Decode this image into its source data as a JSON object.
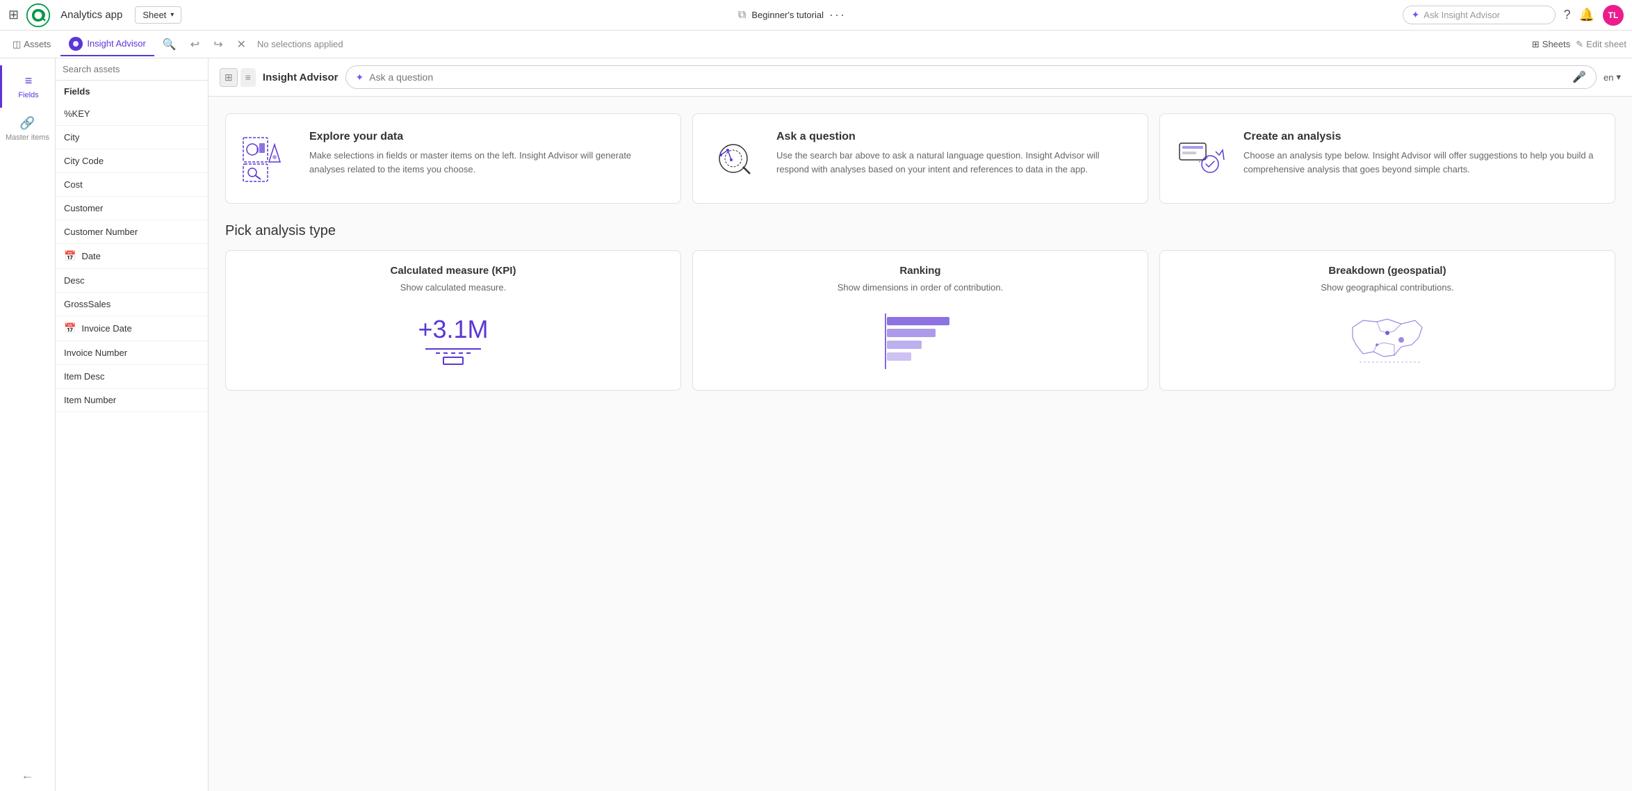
{
  "topNav": {
    "appTitle": "Analytics app",
    "sheetLabel": "Sheet",
    "tutorialLabel": "Beginner's tutorial",
    "askInsightPlaceholder": "Ask Insight Advisor",
    "avatarInitials": "TL"
  },
  "secondToolbar": {
    "assetsLabel": "Assets",
    "insightAdvisorLabel": "Insight Advisor",
    "noSelectionsLabel": "No selections applied",
    "sheetsLabel": "Sheets",
    "editSheetLabel": "Edit sheet"
  },
  "sidebar": {
    "title": "Insight Advisor",
    "searchPlaceholder": "Search assets",
    "fieldsLabel": "Fields",
    "masterItemsLabel": "Master items",
    "fields": [
      {
        "name": "%KEY",
        "type": "text"
      },
      {
        "name": "City",
        "type": "text"
      },
      {
        "name": "City Code",
        "type": "text"
      },
      {
        "name": "Cost",
        "type": "text"
      },
      {
        "name": "Customer",
        "type": "text"
      },
      {
        "name": "Customer Number",
        "type": "text"
      },
      {
        "name": "Date",
        "type": "calendar"
      },
      {
        "name": "Desc",
        "type": "text"
      },
      {
        "name": "GrossSales",
        "type": "text"
      },
      {
        "name": "Invoice Date",
        "type": "calendar"
      },
      {
        "name": "Invoice Number",
        "type": "text"
      },
      {
        "name": "Item Desc",
        "type": "text"
      },
      {
        "name": "Item Number",
        "type": "text"
      }
    ]
  },
  "insightAdvisor": {
    "headerTitle": "Insight Advisor",
    "askPlaceholder": "Ask a question",
    "langLabel": "en",
    "infoCards": [
      {
        "key": "explore",
        "title": "Explore your data",
        "desc": "Make selections in fields or master items on the left. Insight Advisor will generate analyses related to the items you choose."
      },
      {
        "key": "ask",
        "title": "Ask a question",
        "desc": "Use the search bar above to ask a natural language question. Insight Advisor will respond with analyses based on your intent and references to data in the app."
      },
      {
        "key": "create",
        "title": "Create an analysis",
        "desc": "Choose an analysis type below. Insight Advisor will offer suggestions to help you build a comprehensive analysis that goes beyond simple charts."
      }
    ],
    "pickAnalysisTitle": "Pick analysis type",
    "analysisCards": [
      {
        "key": "kpi",
        "title": "Calculated measure (KPI)",
        "desc": "Show calculated measure.",
        "kpiValue": "+3.1M"
      },
      {
        "key": "ranking",
        "title": "Ranking",
        "desc": "Show dimensions in order of contribution."
      },
      {
        "key": "geo",
        "title": "Breakdown (geospatial)",
        "desc": "Show geographical contributions."
      }
    ]
  }
}
